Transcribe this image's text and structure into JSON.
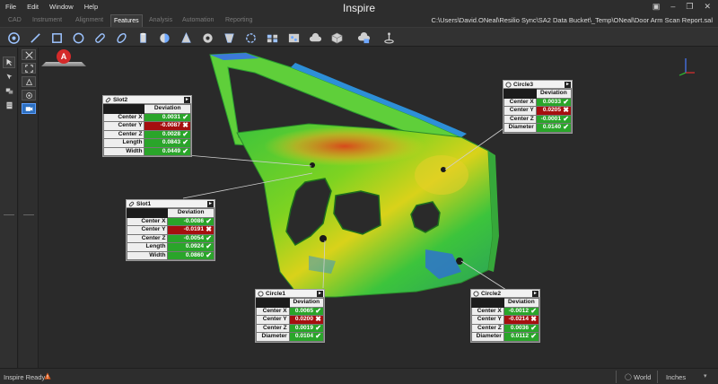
{
  "menu": [
    "File",
    "Edit",
    "Window",
    "Help"
  ],
  "app_title": "Inspire",
  "tabs": [
    {
      "label": "CAD",
      "active": false
    },
    {
      "label": "Instrument",
      "active": false
    },
    {
      "label": "Alignment",
      "active": false
    },
    {
      "label": "Features",
      "active": true
    },
    {
      "label": "Analysis",
      "active": false
    },
    {
      "label": "Automation",
      "active": false
    },
    {
      "label": "Reporting",
      "active": false
    }
  ],
  "file_path": "C:\\Users\\David.ONeal\\Resilio Sync\\SA2 Data Bucket\\_Temp\\ONeal\\Door Arm Scan Report.sal",
  "toolbar_icons": [
    "point-icon",
    "line-icon",
    "plane-icon",
    "circle-icon",
    "slot-icon",
    "ellipse-icon",
    "cylinder-icon",
    "sphere-icon",
    "cone-icon",
    "torus-icon",
    "paraboloid-icon",
    "surface-icon",
    "feature-group-icon",
    "cloud-icon",
    "box-icon",
    "cloud-check-icon",
    "target-icon"
  ],
  "annotation_badge": "A",
  "callouts": {
    "slot2": {
      "name": "Slot2",
      "column": "Deviation",
      "rows": [
        {
          "label": "Center X",
          "value": "0.0031",
          "status": "pass"
        },
        {
          "label": "Center Y",
          "value": "-0.0087",
          "status": "fail"
        },
        {
          "label": "Center Z",
          "value": "0.0028",
          "status": "pass"
        },
        {
          "label": "Length",
          "value": "0.0843",
          "status": "pass"
        },
        {
          "label": "Width",
          "value": "0.0449",
          "status": "pass"
        }
      ]
    },
    "circle3": {
      "name": "Circle3",
      "column": "Deviation",
      "rows": [
        {
          "label": "Center X",
          "value": "0.0033",
          "status": "pass"
        },
        {
          "label": "Center Y",
          "value": "0.0205",
          "status": "fail"
        },
        {
          "label": "Center Z",
          "value": "-0.0001",
          "status": "pass"
        },
        {
          "label": "Diameter",
          "value": "0.0140",
          "status": "pass"
        }
      ]
    },
    "slot1": {
      "name": "Slot1",
      "column": "Deviation",
      "rows": [
        {
          "label": "Center X",
          "value": "-0.0086",
          "status": "pass"
        },
        {
          "label": "Center Y",
          "value": "-0.0191",
          "status": "fail"
        },
        {
          "label": "Center Z",
          "value": "-0.0054",
          "status": "pass"
        },
        {
          "label": "Length",
          "value": "0.0924",
          "status": "pass"
        },
        {
          "label": "Width",
          "value": "0.0860",
          "status": "pass"
        }
      ]
    },
    "circle1": {
      "name": "Circle1",
      "column": "Deviation",
      "rows": [
        {
          "label": "Center X",
          "value": "0.0065",
          "status": "pass"
        },
        {
          "label": "Center Y",
          "value": "0.0200",
          "status": "fail"
        },
        {
          "label": "Center Z",
          "value": "0.0019",
          "status": "pass"
        },
        {
          "label": "Diameter",
          "value": "0.0104",
          "status": "pass"
        }
      ]
    },
    "circle2": {
      "name": "Circle2",
      "column": "Deviation",
      "rows": [
        {
          "label": "Center X",
          "value": "-0.0012",
          "status": "pass"
        },
        {
          "label": "Center Y",
          "value": "-0.0214",
          "status": "fail"
        },
        {
          "label": "Center Z",
          "value": "0.0036",
          "status": "pass"
        },
        {
          "label": "Diameter",
          "value": "0.0112",
          "status": "pass"
        }
      ]
    }
  },
  "status": {
    "text": "Inspire Ready",
    "frame": "World",
    "units": "Inches"
  },
  "colors": {
    "pass": "#2aa52a",
    "fail": "#a50f0f",
    "badge": "#d42a2a"
  }
}
